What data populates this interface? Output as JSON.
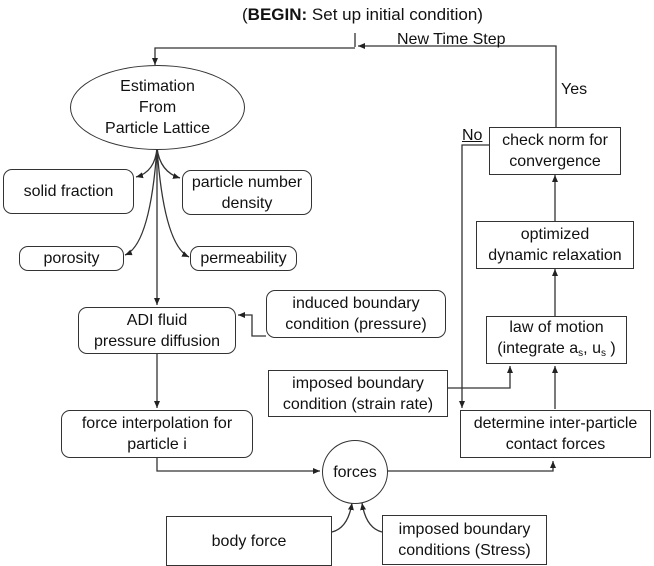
{
  "title": {
    "prefix": "(",
    "bold": "BEGIN:",
    "rest": " Set up initial condition)"
  },
  "edge_labels": {
    "new_time_step": "New Time Step",
    "yes": "Yes",
    "no": "No"
  },
  "nodes": {
    "estimation": "Estimation\nFrom\nParticle Lattice",
    "solid_fraction": "solid fraction",
    "particle_number_density": "particle number\ndensity",
    "porosity": "porosity",
    "permeability": "permeability",
    "adi_fluid": "ADI fluid\npressure diffusion",
    "induced_boundary": "induced boundary\ncondition (pressure)",
    "force_interpolation": "force interpolation for\nparticle i",
    "imposed_strain": "imposed boundary\ncondition (strain rate)",
    "forces": "forces",
    "body_force": "body force",
    "imposed_stress": "imposed boundary\nconditions (Stress)",
    "check_norm": "check norm for\nconvergence",
    "optimized": "optimized\ndynamic relaxation",
    "law_of_motion": {
      "line1": "law of motion",
      "line2_prefix": "(integrate a",
      "sub1": "s",
      "mid": ", u",
      "sub2": "s",
      "suffix": " )"
    },
    "determine_contact": "determine inter-particle\ncontact forces"
  }
}
